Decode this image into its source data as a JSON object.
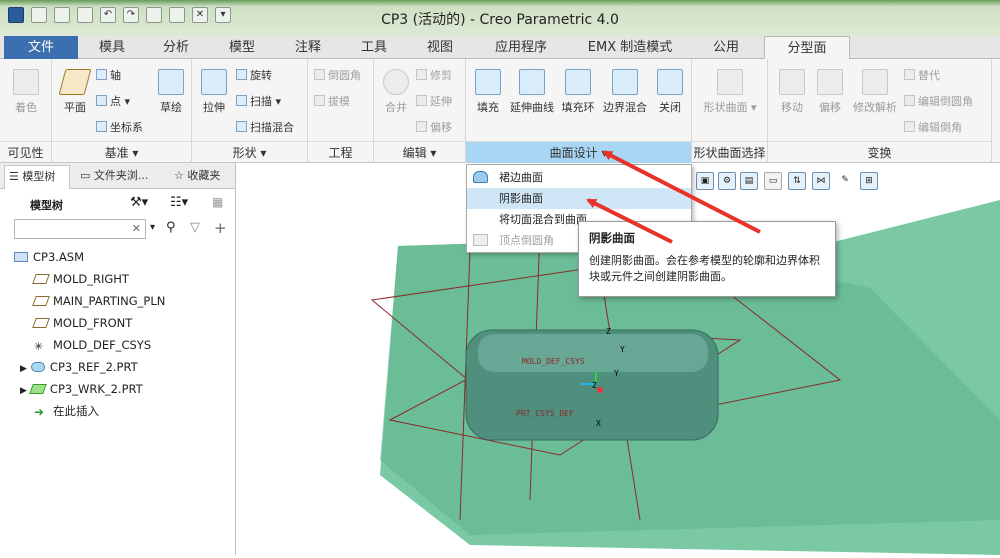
{
  "window": {
    "title": "CP3 (活动的) - Creo Parametric 4.0"
  },
  "tabs": [
    "文件",
    "模具",
    "分析",
    "模型",
    "注释",
    "工具",
    "视图",
    "应用程序",
    "EMX 制造模式",
    "公用",
    "分型面"
  ],
  "groups": {
    "visibility": {
      "label": "可见性",
      "btn": "着色"
    },
    "datum": {
      "label": "基准",
      "plane": "平面",
      "axis": "轴",
      "point": "点",
      "csys": "坐标系",
      "sketch": "草绘"
    },
    "shapes": {
      "label": "形状",
      "extrude": "拉伸",
      "revolve": "旋转",
      "sweep": "扫描",
      "sweep_blend": "扫描混合"
    },
    "engineering": {
      "label": "工程",
      "round": "倒圆角",
      "draft": "拔模"
    },
    "editing": {
      "label": "编辑",
      "merge": "合并",
      "trim": "修剪",
      "extend": "延伸",
      "offset": "偏移"
    },
    "surface_design": {
      "label": "曲面设计",
      "fill": "填充",
      "extend_curve": "延伸曲线",
      "fill_loop": "填充环",
      "boundary_blend": "边界混合",
      "close": "关闭"
    },
    "shape_select": {
      "label": "形状曲面选择",
      "btn": "形状曲面"
    },
    "transform": {
      "label": "变换",
      "move": "移动",
      "offset": "偏移",
      "modify_analytic": "修改解析",
      "replace": "替代",
      "edit_round": "编辑倒圆角",
      "edit_chamfer": "编辑倒角"
    }
  },
  "left_tabs": [
    "模型树",
    "文件夹浏...",
    "收藏夹"
  ],
  "tree": {
    "header": "模型树",
    "search_placeholder": "",
    "items": [
      "CP3.ASM",
      "MOLD_RIGHT",
      "MAIN_PARTING_PLN",
      "MOLD_FRONT",
      "MOLD_DEF_CSYS",
      "CP3_REF_2.PRT",
      "CP3_WRK_2.PRT",
      "在此插入"
    ]
  },
  "dropdown": {
    "items": [
      "裙边曲面",
      "阴影曲面",
      "将切面混合到曲面",
      "顶点倒圆角"
    ]
  },
  "tooltip": {
    "title": "阴影曲面",
    "body": "创建阴影曲面。会在参考模型的轮廓和边界体积块或元件之间创建阴影曲面。"
  },
  "model_labels": {
    "csys": "MOLD_DEF_CSYS",
    "z1": "Z",
    "y1": "Y",
    "z2": "Z",
    "y2": "Y",
    "x": "X",
    "prt": "PRT_CSYS_DEF"
  },
  "colors": {
    "accent": "#3c6faf",
    "highlight": "#a8d6f4",
    "model": "#6cc29a",
    "arrow": "#e8332a"
  }
}
